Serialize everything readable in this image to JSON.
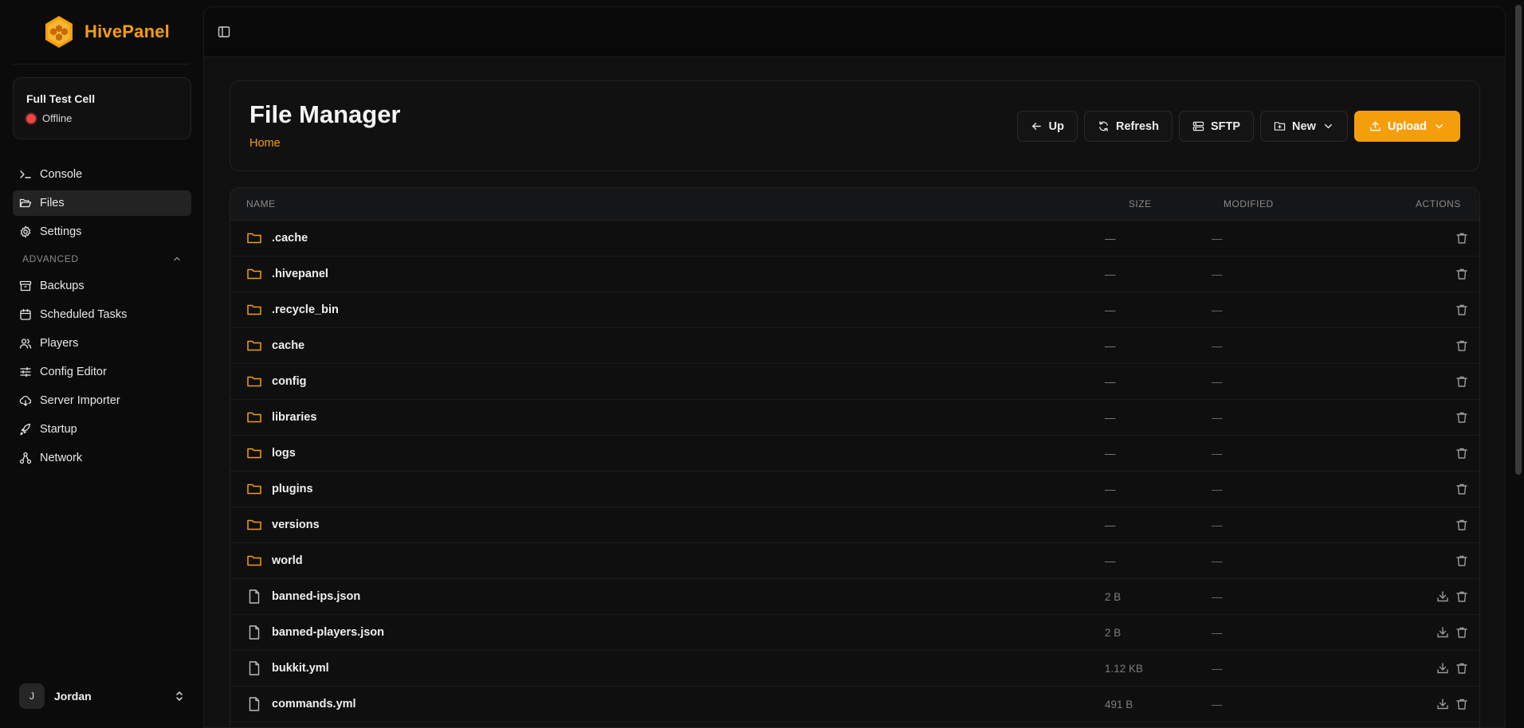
{
  "brand": {
    "name": "HivePanel",
    "accent": "#f59e0b"
  },
  "server": {
    "name": "Full Test Cell",
    "status": "Offline",
    "status_color": "#ef4444"
  },
  "nav": {
    "items": [
      {
        "label": "Console",
        "icon": "terminal-icon"
      },
      {
        "label": "Files",
        "icon": "folder-open-icon",
        "active": true
      },
      {
        "label": "Settings",
        "icon": "gear-icon"
      }
    ],
    "advanced_label": "ADVANCED",
    "advanced_items": [
      {
        "label": "Backups",
        "icon": "archive-icon"
      },
      {
        "label": "Scheduled Tasks",
        "icon": "calendar-icon"
      },
      {
        "label": "Players",
        "icon": "users-icon"
      },
      {
        "label": "Config Editor",
        "icon": "sliders-icon"
      },
      {
        "label": "Server Importer",
        "icon": "cloud-download-icon"
      },
      {
        "label": "Startup",
        "icon": "rocket-icon"
      },
      {
        "label": "Network",
        "icon": "network-icon"
      }
    ]
  },
  "user": {
    "initial": "J",
    "name": "Jordan"
  },
  "page": {
    "title": "File Manager",
    "breadcrumb": "Home"
  },
  "toolbar": {
    "up": "Up",
    "refresh": "Refresh",
    "sftp": "SFTP",
    "new": "New",
    "upload": "Upload"
  },
  "table": {
    "headers": {
      "name": "NAME",
      "size": "SIZE",
      "modified": "MODIFIED",
      "actions": "ACTIONS"
    },
    "rows": [
      {
        "name": ".cache",
        "type": "folder",
        "size": "—",
        "modified": "—"
      },
      {
        "name": ".hivepanel",
        "type": "folder",
        "size": "—",
        "modified": "—"
      },
      {
        "name": ".recycle_bin",
        "type": "folder",
        "size": "—",
        "modified": "—"
      },
      {
        "name": "cache",
        "type": "folder",
        "size": "—",
        "modified": "—"
      },
      {
        "name": "config",
        "type": "folder",
        "size": "—",
        "modified": "—"
      },
      {
        "name": "libraries",
        "type": "folder",
        "size": "—",
        "modified": "—"
      },
      {
        "name": "logs",
        "type": "folder",
        "size": "—",
        "modified": "—"
      },
      {
        "name": "plugins",
        "type": "folder",
        "size": "—",
        "modified": "—"
      },
      {
        "name": "versions",
        "type": "folder",
        "size": "—",
        "modified": "—"
      },
      {
        "name": "world",
        "type": "folder",
        "size": "—",
        "modified": "—"
      },
      {
        "name": "banned-ips.json",
        "type": "file",
        "size": "2 B",
        "modified": "—"
      },
      {
        "name": "banned-players.json",
        "type": "file",
        "size": "2 B",
        "modified": "—"
      },
      {
        "name": "bukkit.yml",
        "type": "file",
        "size": "1.12 KB",
        "modified": "—"
      },
      {
        "name": "commands.yml",
        "type": "file",
        "size": "491 B",
        "modified": "—"
      }
    ]
  }
}
